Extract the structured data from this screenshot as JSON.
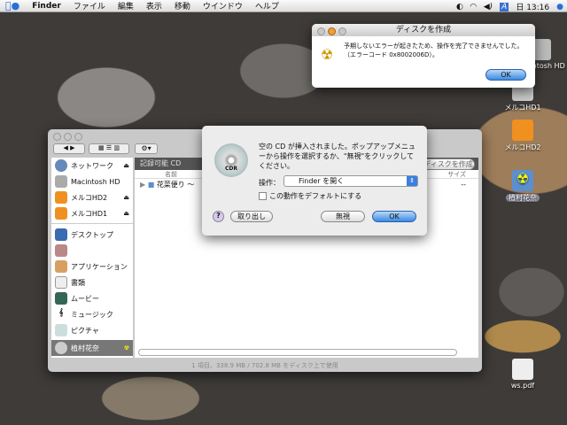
{
  "menubar": {
    "app": "Finder",
    "items": [
      "ファイル",
      "編集",
      "表示",
      "移動",
      "ウインドウ",
      "ヘルプ"
    ],
    "clock": "日 13:16",
    "input": "A"
  },
  "error_dialog": {
    "title": "ディスクを作成",
    "message": "予期しないエラーが起きたため、操作を完了できませんでした。",
    "code": "（エラーコード 0x8002006D）。",
    "ok": "OK"
  },
  "finder": {
    "sidebar": [
      {
        "label": "ネットワーク",
        "eject": true
      },
      {
        "label": "Macintosh HD",
        "eject": false
      },
      {
        "label": "メルコHD2",
        "eject": true
      },
      {
        "label": "メルコHD1",
        "eject": true
      },
      {
        "label": "デスクトップ"
      },
      {
        "label": ""
      },
      {
        "label": "アプリケーション"
      },
      {
        "label": "書類"
      },
      {
        "label": "ムービー"
      },
      {
        "label": "ミュージック"
      },
      {
        "label": "ピクチャ"
      },
      {
        "label": "植村花奈",
        "selected": true
      }
    ],
    "header": "記録可能 CD",
    "burn_button": "ディスクを作成",
    "col_name": "名前",
    "col_size": "サイズ",
    "rows": [
      {
        "name": "花菜便り ～",
        "size": "--"
      }
    ],
    "status": "1 項目、338.9 MB / 702.8 MB をディスク上で使用"
  },
  "cd_dialog": {
    "message": "空の CD が挿入されました。ポップアップメニューから操作を選択するか、\"無視\"をクリックしてください。",
    "action_label": "操作：",
    "action_value": "Finder を開く",
    "default_checkbox": "この動作をデフォルトにする",
    "eject": "取り出し",
    "ignore": "無視",
    "ok": "OK",
    "disc_label": "CDR"
  },
  "desktop": [
    "Macintosh HD",
    "メルコHD1",
    "メルコHD2",
    "植村花奈",
    "ws.pdf"
  ]
}
